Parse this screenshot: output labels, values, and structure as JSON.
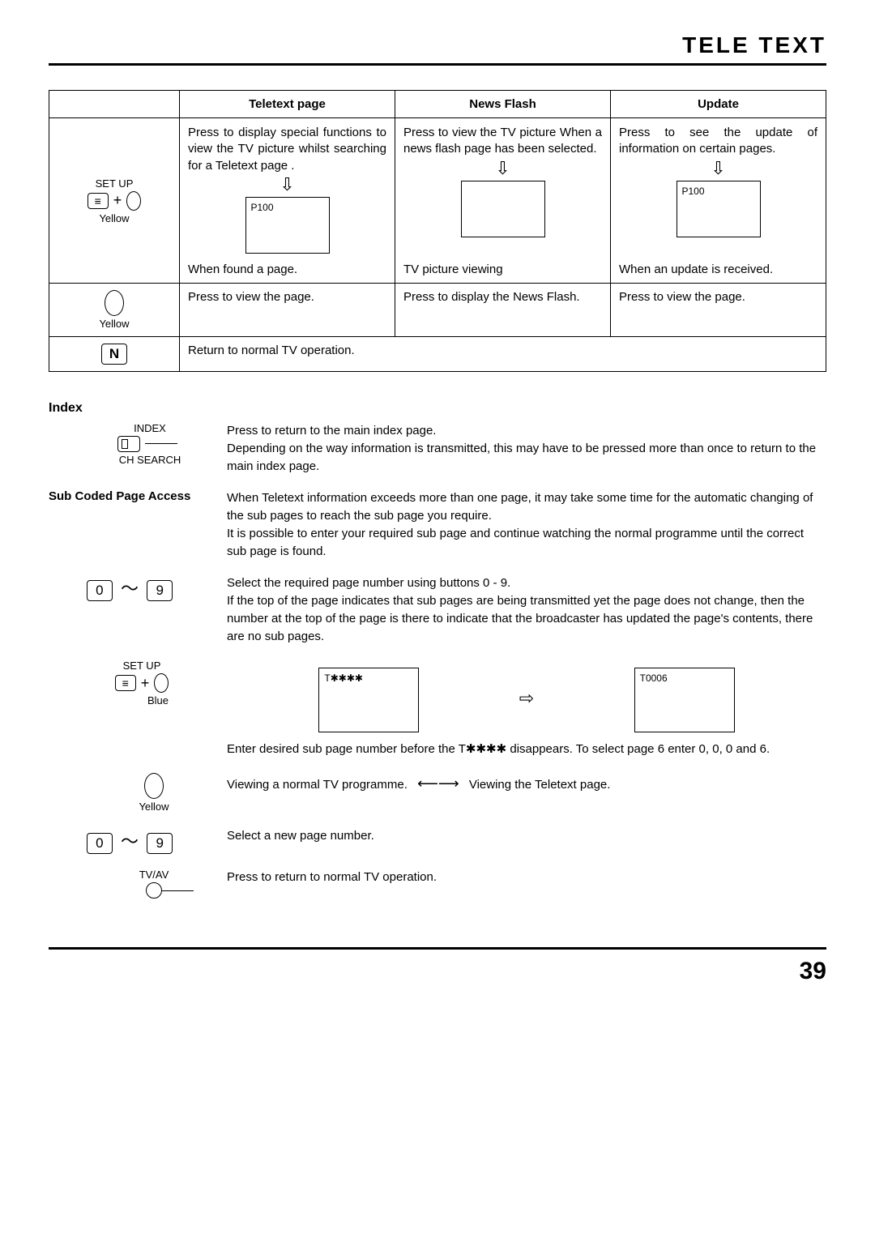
{
  "page": {
    "title": "TELE  TEXT",
    "number": "39"
  },
  "table": {
    "headers": [
      "Teletext page",
      "News Flash",
      "Update"
    ],
    "row1_icon": {
      "setup": "SET UP",
      "color": "Yellow"
    },
    "row1": {
      "teletext": {
        "top": "Press  to display special functions to view the TV picture whilst searching for a Teletext page .",
        "box": "P100",
        "bottom": "When found a page."
      },
      "newsflash": {
        "top": "Press to view the TV picture When a news flash page has been selected.",
        "bottom": "TV picture viewing"
      },
      "update": {
        "top": "Press  to see the update of information on certain pages.",
        "box": "P100",
        "bottom": "When an update is received."
      }
    },
    "row2_icon": "Yellow",
    "row2": {
      "teletext": "Press to view the page.",
      "newsflash": "Press to display the News Flash.",
      "update": "Press to view the page."
    },
    "row3": {
      "key": "N",
      "text": "Return to normal TV operation."
    }
  },
  "index": {
    "title": "Index",
    "icon_top": "INDEX",
    "icon_bottom": "CH SEARCH",
    "text": "Press  to return to the main index page.\nDepending on the way information is transmitted, this may have to be pressed more than once to return to the main index page."
  },
  "subcoded": {
    "title": "Sub Coded Page Access",
    "p1": "When Teletext information exceeds more than one page, it may take some time for the automatic changing of the sub pages to reach the sub page you require.\nIt is possible to enter your required sub page and continue watching the normal programme until the correct sub page is found.",
    "keys09": {
      "zero": "0",
      "nine": "9"
    },
    "p2": "Select the required page number using buttons 0 - 9.\nIf the top of the page indicates that sub pages are being transmitted yet the page does not change, then the number at the top of the page is there to indicate that the broadcaster has updated the page's contents, there are no sub pages.",
    "setup_label": "SET UP",
    "blue": "Blue",
    "box_a": "T✱✱✱✱",
    "box_b": "T0006",
    "p3": "Enter desired sub page number before the T✱✱✱✱ disappears. To select page 6 enter 0, 0, 0 and 6.",
    "yellow_label": "Yellow",
    "p4a": "Viewing a normal TV programme.",
    "p4b": "Viewing the Teletext page.",
    "p5": "Select a new page number.",
    "tvav": "TV/AV",
    "p6": "Press to return to normal TV operation."
  }
}
